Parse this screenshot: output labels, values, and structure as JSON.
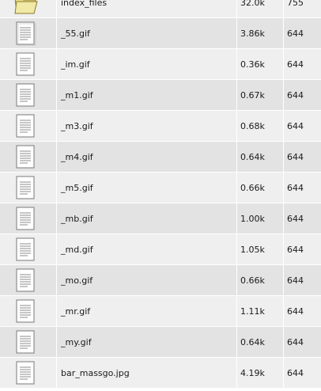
{
  "files": [
    {
      "name": "index_files",
      "size": "32.0k",
      "perm": "755",
      "icon": "folder-icon"
    },
    {
      "name": "_55.gif",
      "size": "3.86k",
      "perm": "644",
      "icon": "document-icon"
    },
    {
      "name": "_im.gif",
      "size": "0.36k",
      "perm": "644",
      "icon": "document-icon"
    },
    {
      "name": "_m1.gif",
      "size": "0.67k",
      "perm": "644",
      "icon": "document-icon"
    },
    {
      "name": "_m3.gif",
      "size": "0.68k",
      "perm": "644",
      "icon": "document-icon"
    },
    {
      "name": "_m4.gif",
      "size": "0.64k",
      "perm": "644",
      "icon": "document-icon"
    },
    {
      "name": "_m5.gif",
      "size": "0.66k",
      "perm": "644",
      "icon": "document-icon"
    },
    {
      "name": "_mb.gif",
      "size": "1.00k",
      "perm": "644",
      "icon": "document-icon"
    },
    {
      "name": "_md.gif",
      "size": "1.05k",
      "perm": "644",
      "icon": "document-icon"
    },
    {
      "name": "_mo.gif",
      "size": "0.66k",
      "perm": "644",
      "icon": "document-icon"
    },
    {
      "name": "_mr.gif",
      "size": "1.11k",
      "perm": "644",
      "icon": "document-icon"
    },
    {
      "name": "_my.gif",
      "size": "0.64k",
      "perm": "644",
      "icon": "document-icon"
    },
    {
      "name": "bar_massgo.jpg",
      "size": "4.19k",
      "perm": "644",
      "icon": "document-icon"
    }
  ],
  "colors": {
    "row_odd": "#efefef",
    "row_even": "#e3e3e3",
    "folder_fill": "#ede59a",
    "folder_stroke": "#8a7c2a"
  }
}
